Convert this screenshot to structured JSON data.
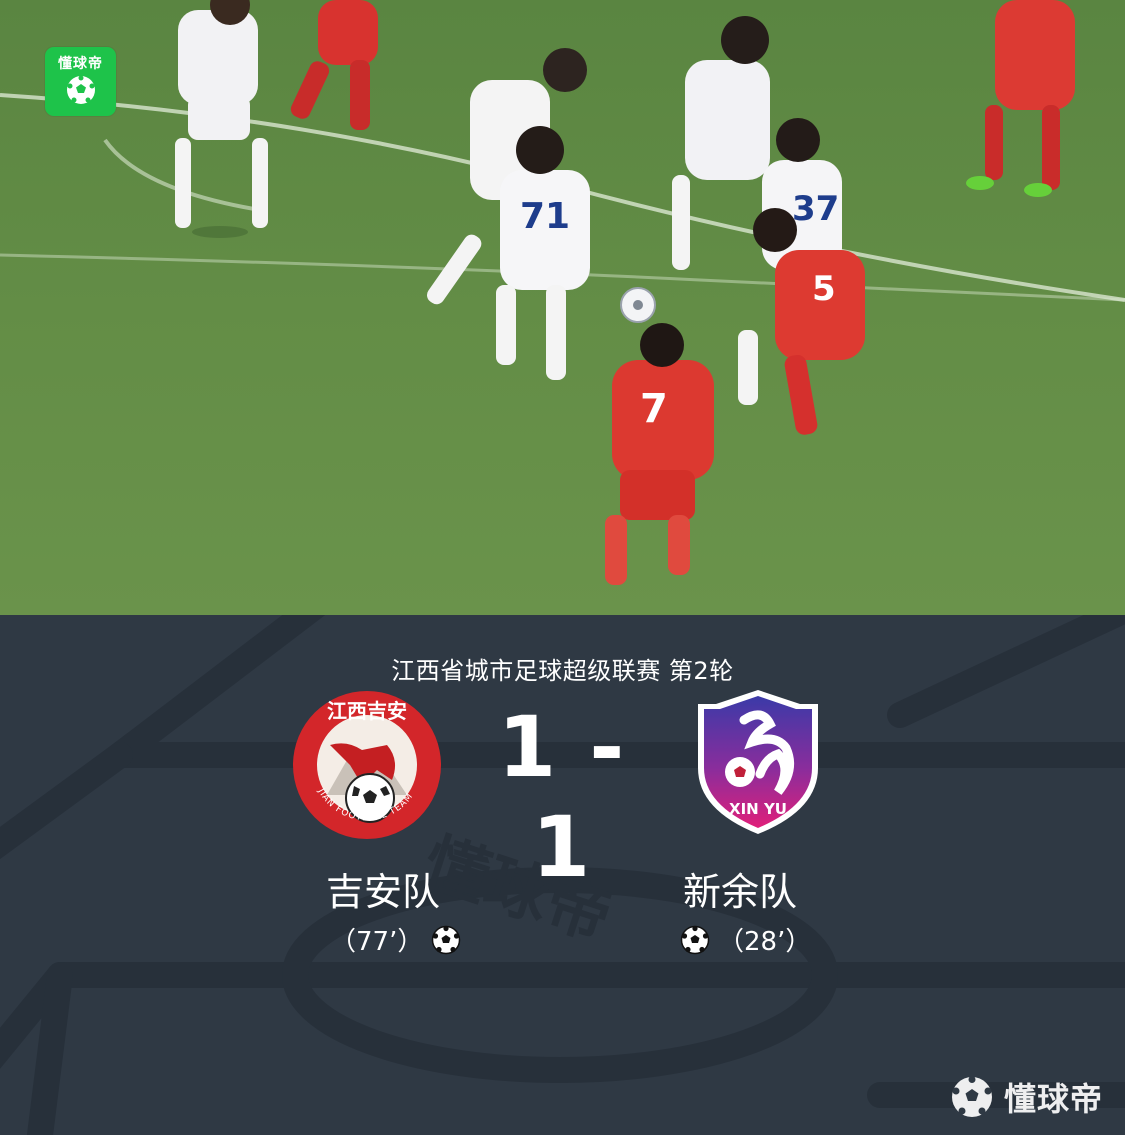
{
  "photo": {
    "badge_text": "懂球帝",
    "jersey_numbers": [
      "71",
      "37",
      "7",
      "5"
    ]
  },
  "match": {
    "league_round": "江西省城市足球超级联赛 第2轮",
    "score": "1 - 1",
    "home": {
      "name": "吉安队",
      "goal_time": "（77’）",
      "crest_text_top": "江西吉安",
      "crest_text_bottom": "JIAN FOOTBALL TEAM"
    },
    "away": {
      "name": "新余队",
      "goal_time": "（28’）",
      "crest_text": "XIN YU"
    }
  },
  "watermark": "懂球帝",
  "colors": {
    "pitch": "#5e8a43",
    "board_bg": "#2f3944",
    "home_red": "#d3262a",
    "away_purple": "#5b2d8e",
    "away_pink": "#e0207a",
    "badge_green": "#1ec34a"
  }
}
